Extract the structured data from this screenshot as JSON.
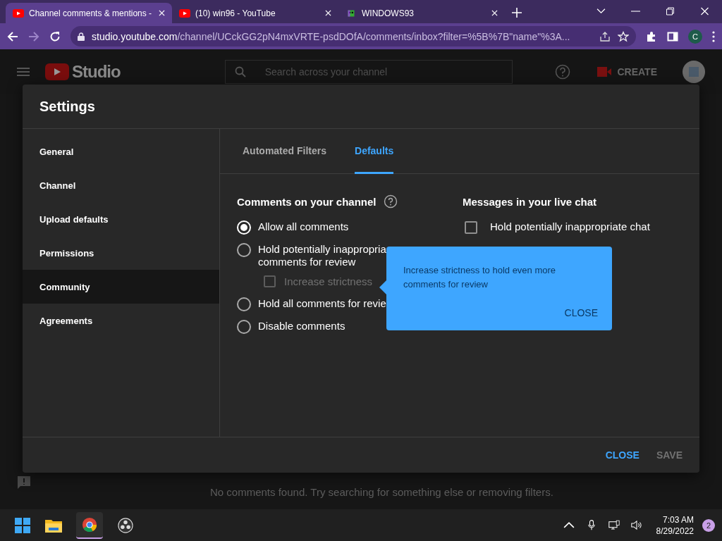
{
  "browser": {
    "tabs": [
      {
        "title": "Channel comments & mentions -",
        "selected": true,
        "kind": "youtube"
      },
      {
        "title": "(10) win96 - YouTube",
        "selected": false,
        "kind": "youtube"
      },
      {
        "title": "WINDOWS93",
        "selected": false,
        "kind": "pixel"
      }
    ],
    "nav": [
      {
        "kind": "back",
        "disabled": false
      },
      {
        "kind": "forward",
        "disabled": true
      },
      {
        "kind": "reload",
        "disabled": false
      }
    ],
    "url_host": "studio.youtube.com",
    "url_path": "/channel/UCckGG2pN4mxVRTE-psdDOfA/comments/inbox?filter=%5B%7B\"name\"%3A...",
    "profile": "C"
  },
  "studio": {
    "logo": "Studio",
    "search": {
      "placeholder": "Search across your channel"
    },
    "create": "CREATE",
    "empty_message": "No comments found. Try searching for something else or removing filters."
  },
  "dialog": {
    "title": "Settings",
    "nav": [
      {
        "label": "General",
        "selected": false
      },
      {
        "label": "Channel",
        "selected": false
      },
      {
        "label": "Upload defaults",
        "selected": false
      },
      {
        "label": "Permissions",
        "selected": false
      },
      {
        "label": "Community",
        "selected": true
      },
      {
        "label": "Agreements",
        "selected": false
      }
    ],
    "tabs": [
      {
        "label": "Automated Filters",
        "selected": false
      },
      {
        "label": "Defaults",
        "selected": true
      }
    ],
    "comments": {
      "heading": "Comments on your channel",
      "options": [
        {
          "lines": [
            "Allow all comments"
          ],
          "selected": true
        },
        {
          "lines": [
            "Hold potentially inappropria",
            "comments for review"
          ],
          "selected": false,
          "sub": {
            "label": "Increase strictness",
            "checked": false,
            "disabled": true
          }
        },
        {
          "lines": [
            "Hold all comments for revie"
          ],
          "selected": false
        },
        {
          "lines": [
            "Disable comments"
          ],
          "selected": false
        }
      ]
    },
    "live_chat": {
      "heading": "Messages in your live chat",
      "option": {
        "lines": [
          "Hold potentially inappropriate chat"
        ],
        "checked": false
      }
    },
    "tooltip": {
      "text": "Increase strictness to hold even more comments for review",
      "close": "CLOSE"
    },
    "buttons": [
      {
        "label": "CLOSE",
        "kind": "primary"
      },
      {
        "label": "SAVE",
        "kind": "disabled"
      }
    ]
  },
  "taskbar": {
    "time": "7:03 AM",
    "date": "8/29/2022",
    "notifications": "2"
  }
}
